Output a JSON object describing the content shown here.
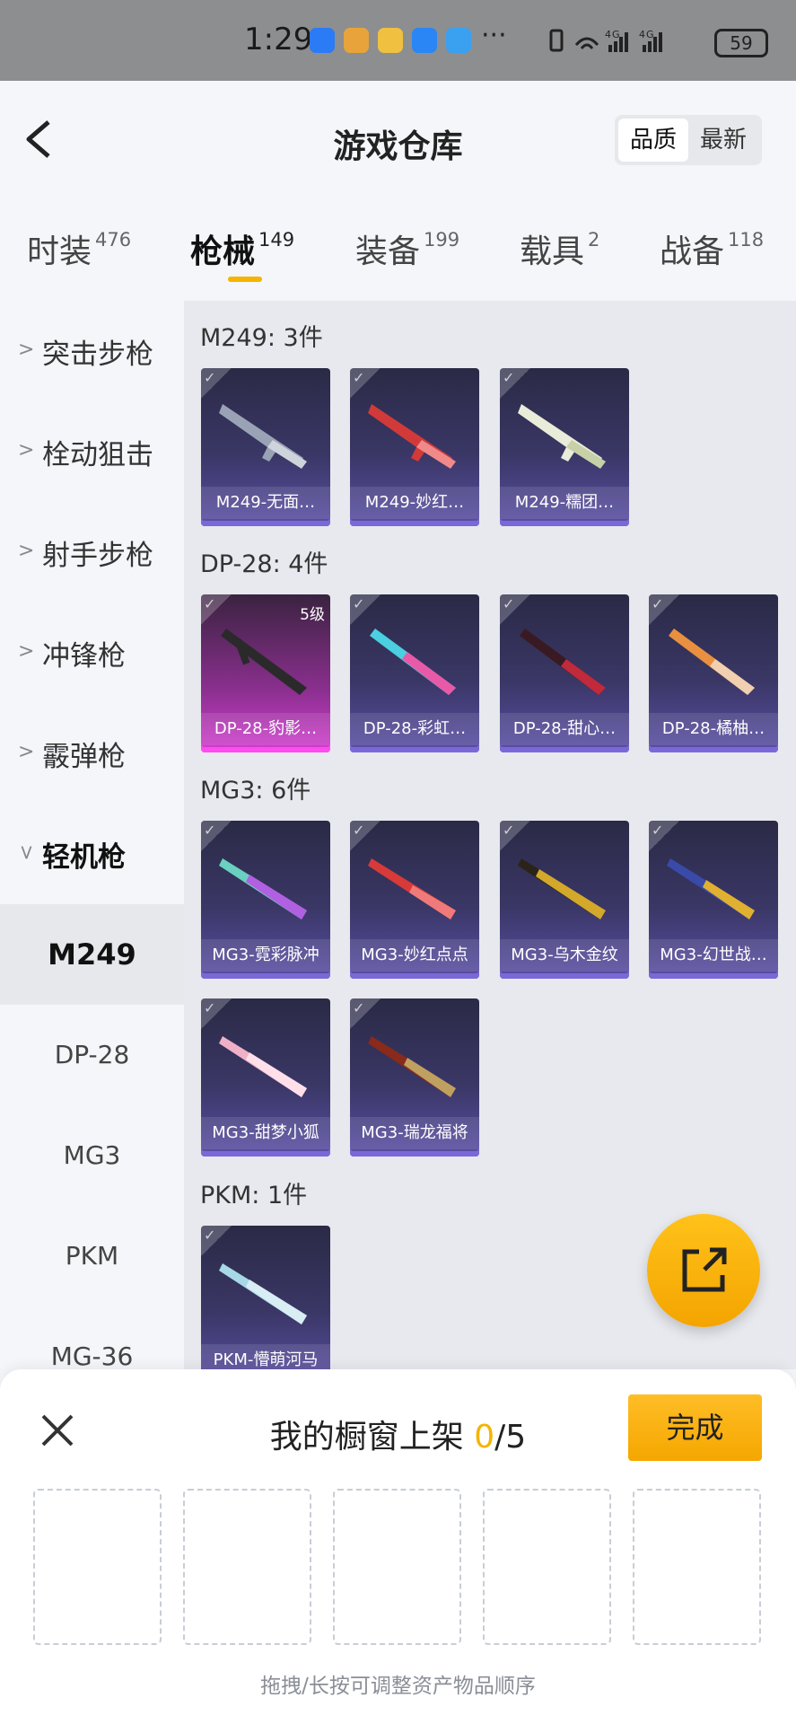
{
  "status_bar": {
    "time": "1:29",
    "network": "4G 4G",
    "battery": "59"
  },
  "header": {
    "title": "游戏仓库",
    "sort_options": [
      "品质",
      "最新"
    ],
    "sort_selected": "品质"
  },
  "tabs": [
    {
      "label": "时装",
      "count": "476"
    },
    {
      "label": "枪械",
      "count": "149",
      "active": true
    },
    {
      "label": "装备",
      "count": "199"
    },
    {
      "label": "载具",
      "count": "2"
    },
    {
      "label": "战备",
      "count": "118"
    }
  ],
  "sidebar": {
    "categories": [
      "突击步枪",
      "栓动狙击",
      "射手步枪",
      "冲锋枪",
      "霰弹枪",
      "轻机枪"
    ],
    "subitems": [
      "M249",
      "DP-28",
      "MG3",
      "PKM",
      "MG-36"
    ],
    "selected_subitem": "M249"
  },
  "groups": [
    {
      "title": "M249: 3件",
      "items": [
        {
          "name": "M249-无面…"
        },
        {
          "name": "M249-妙红…"
        },
        {
          "name": "M249-糯团…"
        }
      ]
    },
    {
      "title": "DP-28: 4件",
      "items": [
        {
          "name": "DP-28-豹影…",
          "level": "5级"
        },
        {
          "name": "DP-28-彩虹…"
        },
        {
          "name": "DP-28-甜心…"
        },
        {
          "name": "DP-28-橘柚…"
        }
      ]
    },
    {
      "title": "MG3: 6件",
      "items": [
        {
          "name": "MG3-霓彩脉冲"
        },
        {
          "name": "MG3-妙红点点"
        },
        {
          "name": "MG3-乌木金纹"
        },
        {
          "name": "MG3-幻世战…"
        },
        {
          "name": "MG3-甜梦小狐"
        },
        {
          "name": "MG3-瑞龙福将"
        }
      ]
    },
    {
      "title": "PKM: 1件",
      "items": [
        {
          "name": "PKM-懵萌河马"
        }
      ]
    }
  ],
  "sheet": {
    "title_prefix": "我的橱窗上架 ",
    "current": "0",
    "total": "/5",
    "done_label": "完成",
    "hint": "拖拽/长按可调整资产物品顺序"
  },
  "colors": {
    "accent": "#f5b400",
    "card_purple": "#3a3766",
    "card_pink": "#d33fd0"
  }
}
